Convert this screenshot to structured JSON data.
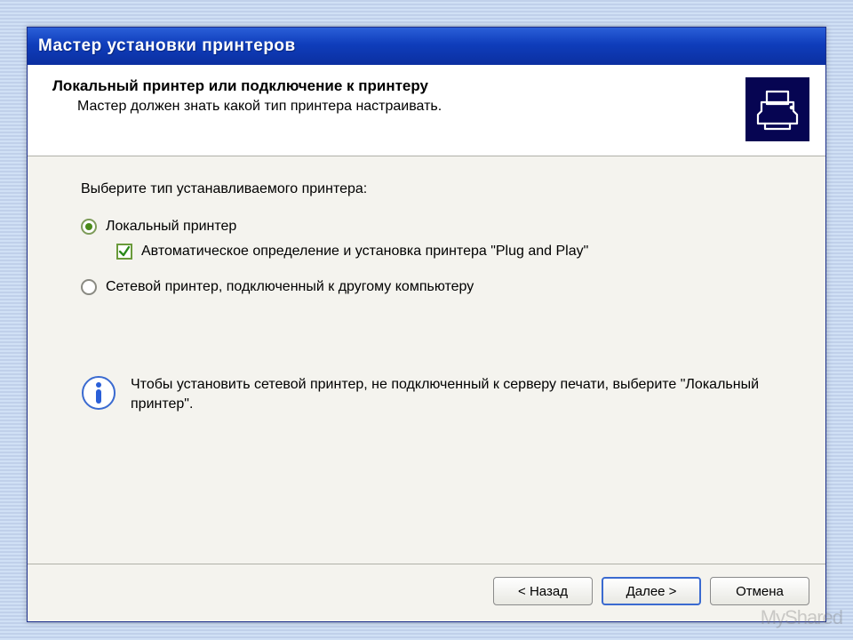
{
  "window": {
    "title": "Мастер установки принтеров"
  },
  "header": {
    "title": "Локальный принтер или подключение к принтеру",
    "subtitle": "Мастер должен знать какой тип принтера настраивать.",
    "icon": "printer-icon"
  },
  "content": {
    "prompt": "Выберите тип устанавливаемого принтера:",
    "option_local": "Локальный принтер",
    "option_local_selected": true,
    "checkbox_pnp": "Автоматическое определение и установка принтера \"Plug and Play\"",
    "checkbox_pnp_checked": true,
    "option_network": "Сетевой принтер, подключенный к другому компьютеру",
    "option_network_selected": false
  },
  "info": {
    "text": "Чтобы установить сетевой принтер, не подключенный к серверу печати, выберите \"Локальный принтер\"."
  },
  "buttons": {
    "back": "< Назад",
    "next": "Далее >",
    "cancel": "Отмена"
  },
  "watermark": "MyShared"
}
